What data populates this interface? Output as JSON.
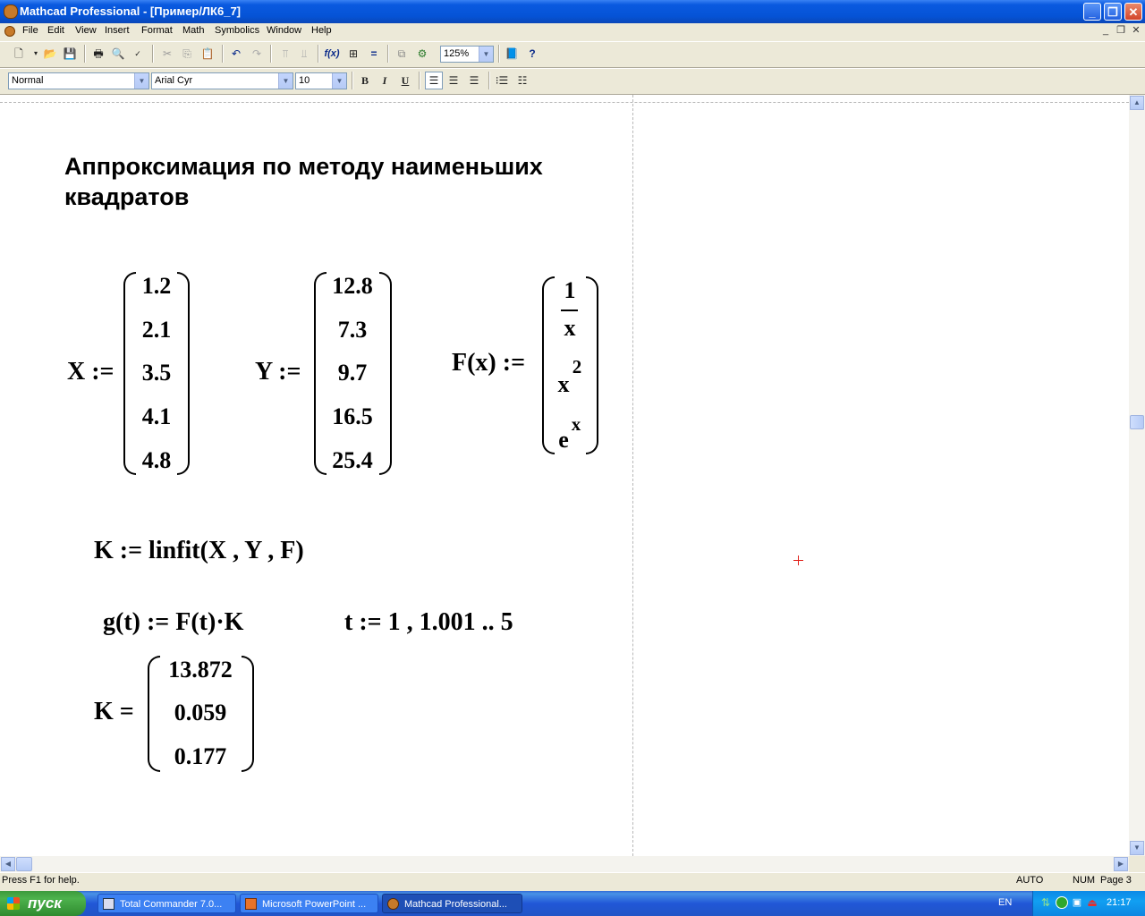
{
  "window": {
    "title": "Mathcad Professional - [Пример/ЛК6_7]",
    "controls": {
      "minimize": "_",
      "restore": "❐",
      "close": "✕"
    }
  },
  "menu": [
    "File",
    "Edit",
    "View",
    "Insert",
    "Format",
    "Math",
    "Symbolics",
    "Window",
    "Help"
  ],
  "toolbar": {
    "zoom": "125%"
  },
  "format_bar": {
    "style": "Normal",
    "font": "Arial Cyr",
    "size": "10",
    "bold": "B",
    "italic": "I",
    "underline": "U"
  },
  "document": {
    "heading_line1": "Аппроксимация по методу наименьших",
    "heading_line2": "квадратов",
    "x_def_label": "X :=",
    "x_values": [
      "1.2",
      "2.1",
      "3.5",
      "4.1",
      "4.8"
    ],
    "y_def_label": "Y :=",
    "y_values": [
      "12.8",
      "7.3",
      "9.7",
      "16.5",
      "25.4"
    ],
    "f_def_label": "F(x) :=",
    "f_entries": {
      "frac_num": "1",
      "frac_den": "x",
      "power_base": "x",
      "power_exp": "2",
      "exp_base": "e",
      "exp_exp": "x"
    },
    "k_linfit": "K := linfit(X , Y , F)",
    "g_def": "g(t) := F(t)·K",
    "t_def": "t := 1 , 1.001 .. 5",
    "k_result_label": "K =",
    "k_values": [
      "13.872",
      "0.059",
      "0.177"
    ]
  },
  "status": {
    "help": "Press F1 for help.",
    "mode": "AUTO",
    "num": "NUM",
    "page": "Page 3"
  },
  "taskbar": {
    "start": "пуск",
    "tasks": [
      "Total Commander 7.0...",
      "Microsoft PowerPoint ...",
      "Mathcad Professional..."
    ],
    "lang": "EN",
    "clock": "21:17"
  },
  "colors": {
    "titlebar": "#0553d6",
    "cursor": "#e0201a",
    "taskbar": "#2157d7"
  }
}
